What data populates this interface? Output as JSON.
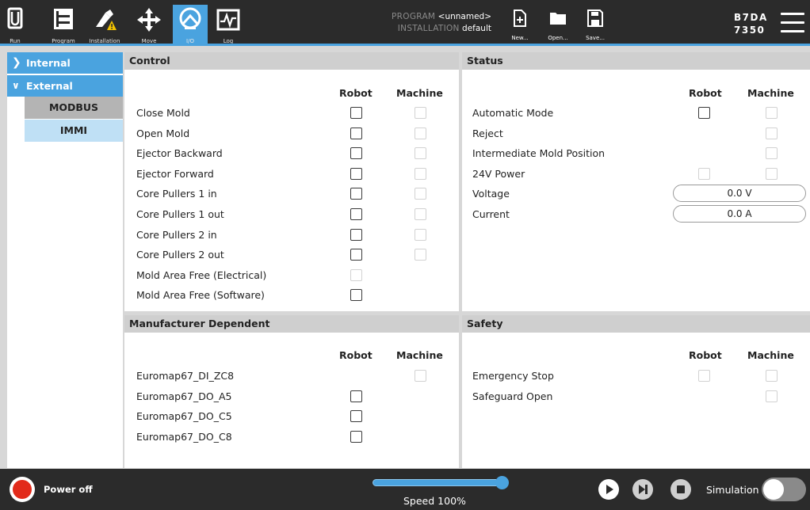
{
  "nav": {
    "run": "Run",
    "program": "Program",
    "installation": "Installation",
    "move": "Move",
    "io": "I/O",
    "log": "Log"
  },
  "program_info": {
    "program_key": "PROGRAM",
    "program_value": "<unnamed>",
    "installation_key": "INSTALLATION",
    "installation_value": "default"
  },
  "file": {
    "new": "New...",
    "open": "Open...",
    "save": "Save..."
  },
  "serial": {
    "line1": "B7DA",
    "line2": "7350"
  },
  "leftnav": {
    "internal": "Internal",
    "external": "External",
    "modbus": "MODBUS",
    "immi": "IMMI"
  },
  "columns": {
    "robot": "Robot",
    "machine": "Machine"
  },
  "control": {
    "title": "Control",
    "rows": [
      {
        "label": "Close Mold",
        "robot": "enabled",
        "machine": "disabled"
      },
      {
        "label": "Open Mold",
        "robot": "enabled",
        "machine": "disabled"
      },
      {
        "label": "Ejector Backward",
        "robot": "enabled",
        "machine": "disabled"
      },
      {
        "label": "Ejector Forward",
        "robot": "enabled",
        "machine": "disabled"
      },
      {
        "label": "Core Pullers 1 in",
        "robot": "enabled",
        "machine": "disabled"
      },
      {
        "label": "Core Pullers 1 out",
        "robot": "enabled",
        "machine": "disabled"
      },
      {
        "label": "Core Pullers 2 in",
        "robot": "enabled",
        "machine": "disabled"
      },
      {
        "label": "Core Pullers 2 out",
        "robot": "enabled",
        "machine": "disabled"
      },
      {
        "label": "Mold Area Free (Electrical)",
        "robot": "disabled",
        "machine": "none"
      },
      {
        "label": "Mold Area Free (Software)",
        "robot": "enabled",
        "machine": "none"
      }
    ]
  },
  "status": {
    "title": "Status",
    "rows": [
      {
        "label": "Automatic Mode",
        "robot": "enabled",
        "machine": "disabled"
      },
      {
        "label": "Reject",
        "robot": "none",
        "machine": "disabled"
      },
      {
        "label": "Intermediate Mold Position",
        "robot": "none",
        "machine": "disabled"
      },
      {
        "label": "24V Power",
        "robot": "disabled",
        "machine": "disabled"
      }
    ],
    "voltage_label": "Voltage",
    "voltage_value": "0.0 V",
    "current_label": "Current",
    "current_value": "0.0 A"
  },
  "manufacturer": {
    "title": "Manufacturer Dependent",
    "rows": [
      {
        "label": "Euromap67_DI_ZC8",
        "robot": "none",
        "machine": "disabled"
      },
      {
        "label": "Euromap67_DO_A5",
        "robot": "enabled",
        "machine": "none"
      },
      {
        "label": "Euromap67_DO_C5",
        "robot": "enabled",
        "machine": "none"
      },
      {
        "label": "Euromap67_DO_C8",
        "robot": "enabled",
        "machine": "none"
      }
    ]
  },
  "safety": {
    "title": "Safety",
    "rows": [
      {
        "label": "Emergency Stop",
        "robot": "disabled",
        "machine": "disabled"
      },
      {
        "label": "Safeguard Open",
        "robot": "none",
        "machine": "disabled"
      }
    ]
  },
  "footer": {
    "power_label": "Power off",
    "speed_label": "Speed 100%",
    "speed_percent": 100,
    "simulation_label": "Simulation",
    "simulation_on": false
  },
  "colors": {
    "accent": "#4aa3df",
    "header_bg": "#2b2b2b",
    "power_off_red": "#e22a1a"
  }
}
